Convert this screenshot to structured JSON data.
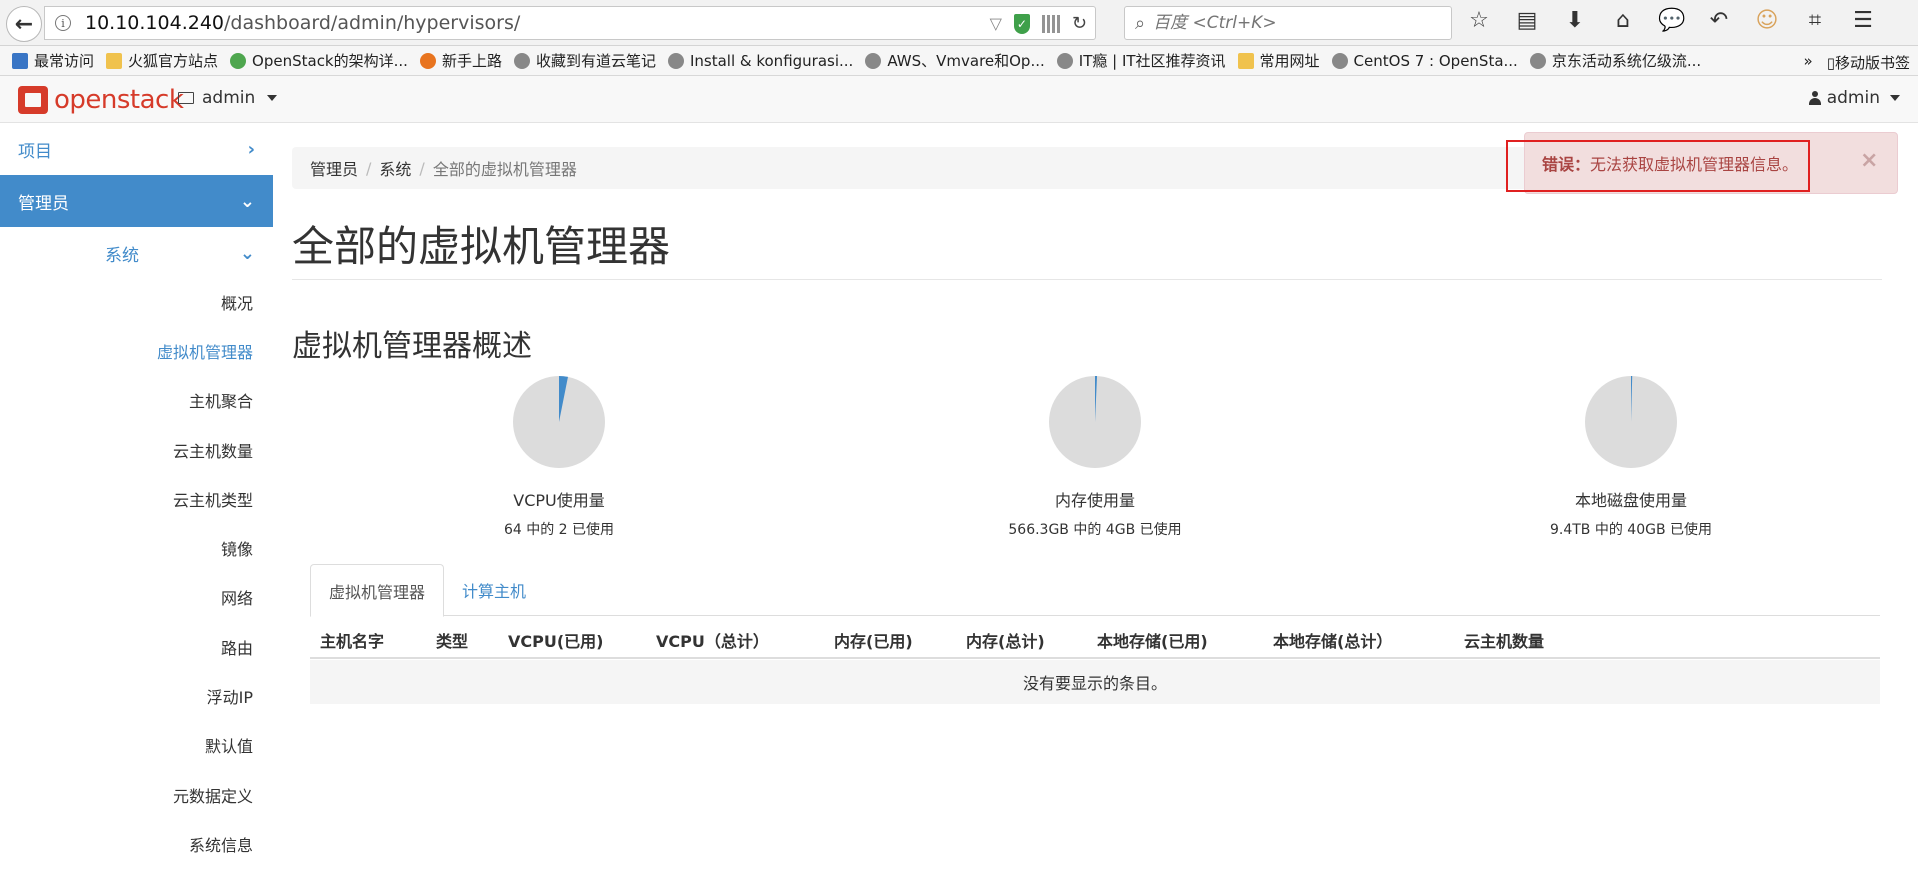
{
  "browser": {
    "url_host": "10.10.104.240",
    "url_path": "/dashboard/admin/hypervisors/",
    "search_placeholder": "百度 <Ctrl+K>"
  },
  "bookmarks": {
    "items": [
      "最常访问",
      "火狐官方站点",
      "OpenStack的架构详...",
      "新手上路",
      "收藏到有道云笔记",
      "Install & konfigurasi...",
      "AWS、Vmvare和Op...",
      "IT瘾 | IT社区推荐资讯",
      "常用网址",
      "CentOS 7 : OpenSta...",
      "京东活动系统亿级流..."
    ],
    "overflow": "»",
    "mobile": "移动版书签"
  },
  "navbar": {
    "logo_text": "openstack",
    "project": "admin",
    "user": "admin"
  },
  "sidebar": {
    "project": "项目",
    "admin": "管理员",
    "system": "系统",
    "items": [
      "概况",
      "虚拟机管理器",
      "主机聚合",
      "云主机数量",
      "云主机类型",
      "镜像",
      "网络",
      "路由",
      "浮动IP",
      "默认值",
      "元数据定义",
      "系统信息"
    ],
    "active_index": 1
  },
  "breadcrumb": [
    "管理员",
    "系统",
    "全部的虚拟机管理器"
  ],
  "page_title": "全部的虚拟机管理器",
  "overview_title": "虚拟机管理器概述",
  "usage": [
    {
      "label": "VCPU使用量",
      "detail": "64 中的 2 已使用",
      "used": 2,
      "total": 64
    },
    {
      "label": "内存使用量",
      "detail": "566.3GB 中的 4GB 已使用",
      "used": 4,
      "total": 566.3
    },
    {
      "label": "本地磁盘使用量",
      "detail": "9.4TB 中的 40GB 已使用",
      "used": 0.04,
      "total": 9.4
    }
  ],
  "colors": {
    "pie_used": "#428bca",
    "pie_free": "#dcdcdc"
  },
  "tabs": [
    "虚拟机管理器",
    "计算主机"
  ],
  "table": {
    "columns": [
      "主机名字",
      "类型",
      "VCPU(已用)",
      "VCPU（总计）",
      "内存(已用)",
      "内存(总计)",
      "本地存储(已用)",
      "本地存储(总计）",
      "云主机数量"
    ],
    "empty": "没有要显示的条目。"
  },
  "alert": {
    "prefix": "错误：",
    "message": "无法获取虚拟机管理器信息。",
    "close": "×"
  }
}
